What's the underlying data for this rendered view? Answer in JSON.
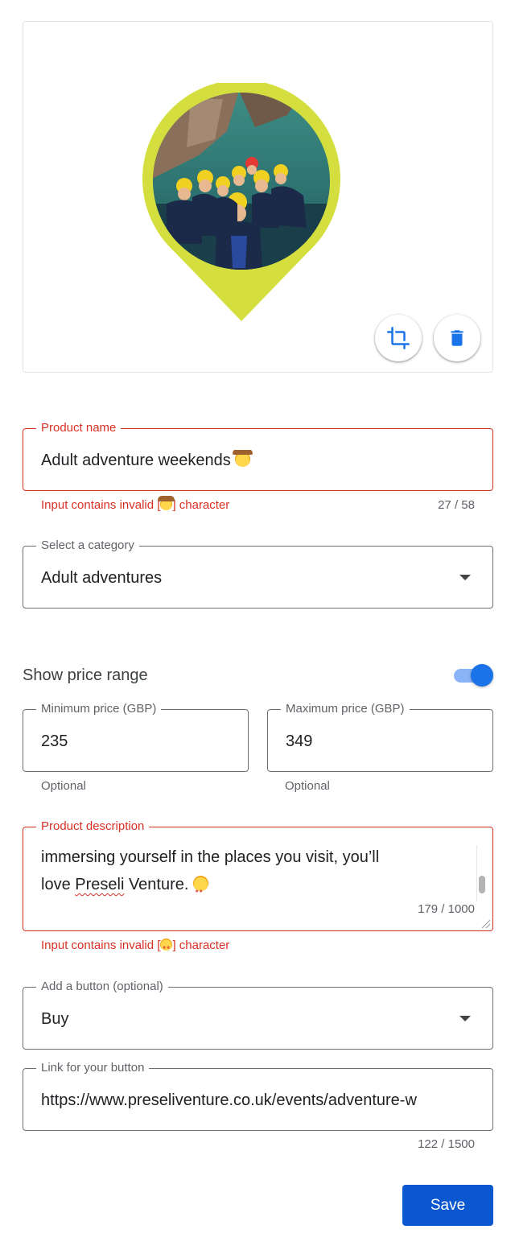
{
  "image_card": {
    "photo_alt": "Group of people in wetsuits and helmets in the sea",
    "pin_color": "#d4df3f",
    "crop_icon": "crop-icon",
    "delete_icon": "trash-icon"
  },
  "product_name": {
    "label": "Product name",
    "value": "Adult adventure weekends",
    "error_prefix": "Input contains invalid [",
    "error_suffix": "] character",
    "counter": "27 / 58"
  },
  "category": {
    "label": "Select a category",
    "value": "Adult adventures"
  },
  "price_range": {
    "toggle_label": "Show price range",
    "enabled": true,
    "min": {
      "label": "Minimum price (GBP)",
      "value": "235",
      "helper": "Optional"
    },
    "max": {
      "label": "Maximum price (GBP)",
      "value": "349",
      "helper": "Optional"
    }
  },
  "description": {
    "label": "Product description",
    "line1": "immersing yourself in the places you visit, you’ll",
    "line2_a": "love ",
    "line2_misspelled": "Preseli",
    "line2_b": " Venture.",
    "counter": "179 / 1000",
    "error_prefix": "Input contains invalid [",
    "error_suffix": "] character"
  },
  "button_select": {
    "label": "Add a button (optional)",
    "value": "Buy"
  },
  "button_link": {
    "label": "Link for your button",
    "value": "https://www.preseliventure.co.uk/events/adventure-w",
    "counter": "122 / 1500"
  },
  "colors": {
    "accent": "#1a73e8",
    "save_bg": "#0b57d0",
    "error": "#d93025"
  },
  "actions": {
    "save_label": "Save"
  }
}
